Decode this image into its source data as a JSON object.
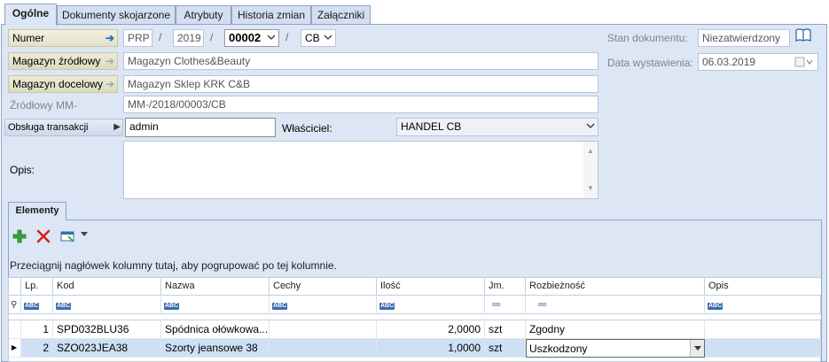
{
  "tabs": [
    {
      "label": "Ogólne"
    },
    {
      "label": "Dokumenty skojarzone"
    },
    {
      "label": "Atrybuty"
    },
    {
      "label": "Historia zmian"
    },
    {
      "label": "Załączniki"
    }
  ],
  "numer": {
    "label": "Numer",
    "prefix": "PRP",
    "slash": "/",
    "year": "2019",
    "number": "00002",
    "series": "CB"
  },
  "magazyn_zrodlowy": {
    "label": "Magazyn źródłowy",
    "value": "Magazyn Clothes&Beauty"
  },
  "magazyn_docelowy": {
    "label": "Magazyn docelowy",
    "value": "Magazyn Sklep KRK C&B"
  },
  "zrodlowy_mm": {
    "label": "Źródłowy MM-",
    "value": "MM-/2018/00003/CB"
  },
  "obsluga": {
    "label": "Obsługa transakcji",
    "value": "admin"
  },
  "wlasciciel": {
    "label": "Właściciel:",
    "value": "HANDEL CB"
  },
  "opis": {
    "label": "Opis:",
    "value": ""
  },
  "stan": {
    "label": "Stan dokumentu:",
    "value": "Niezatwierdzony"
  },
  "data": {
    "label": "Data wystawienia:",
    "value": "06.03.2019"
  },
  "elements_tab": "Elementy",
  "toolbar": {
    "add": "add-icon",
    "delete": "delete-icon",
    "group": "table-options-icon"
  },
  "group_hint": "Przeciągnij nagłówek kolumny tutaj, aby pogrupować po tej kolumnie.",
  "filter_abc": "ABC",
  "columns": [
    "Lp.",
    "Kod",
    "Nazwa",
    "Cechy",
    "Ilość",
    "Jm.",
    "Rozbieżność",
    "Opis"
  ],
  "rows": [
    {
      "lp": "1",
      "kod": "SPD032BLU36",
      "nazwa": "Spódnica ołówkowa...",
      "cechy": "",
      "ilosc": "2,0000",
      "jm": "szt",
      "rozb": "Zgodny",
      "opis": ""
    },
    {
      "lp": "2",
      "kod": "SZO023JEA38",
      "nazwa": "Szorty jeansowe 38",
      "cechy": "",
      "ilosc": "1,0000",
      "jm": "szt",
      "rozb": "Uszkodzony",
      "opis": ""
    }
  ],
  "colors": {
    "panel": "#dce6f5",
    "border": "#8ea4c4",
    "label_btn": "#e4e3cb",
    "selected_row": "#cfe0f5",
    "icon_add": "#3aa03a",
    "icon_delete": "#d42020"
  }
}
